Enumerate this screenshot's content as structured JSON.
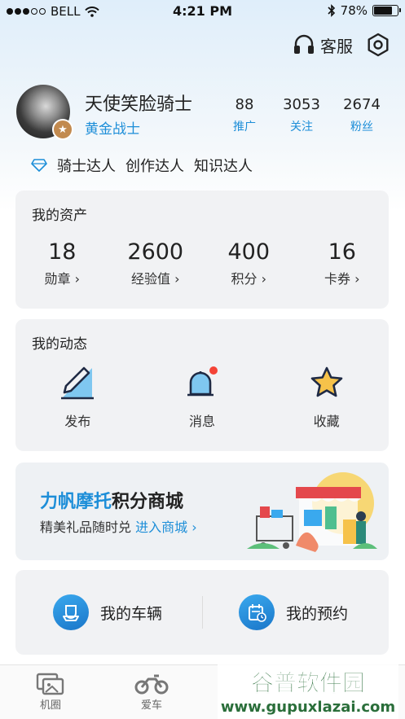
{
  "status_bar": {
    "carrier": "BELL",
    "time": "4:21 PM",
    "battery": "78%",
    "battery_level": 0.78
  },
  "header": {
    "service_label": "客服",
    "service_icon": "headset-icon",
    "settings_icon": "hex-nut-icon"
  },
  "profile": {
    "nickname": "天使笑脸骑士",
    "rank": "黄金战士",
    "stats": [
      {
        "value": "88",
        "label": "推广"
      },
      {
        "value": "3053",
        "label": "关注"
      },
      {
        "value": "2674",
        "label": "粉丝"
      }
    ],
    "tags": [
      "骑士达人",
      "创作达人",
      "知识达人"
    ]
  },
  "assets": {
    "title": "我的资产",
    "items": [
      {
        "value": "18",
        "label": "勋章 ›"
      },
      {
        "value": "2600",
        "label": "经验值 ›"
      },
      {
        "value": "400",
        "label": "积分 ›"
      },
      {
        "value": "16",
        "label": "卡券 ›"
      }
    ]
  },
  "dynamic": {
    "title": "我的动态",
    "items": [
      {
        "label": "发布",
        "icon": "pencil-icon"
      },
      {
        "label": "消息",
        "icon": "bell-icon"
      },
      {
        "label": "收藏",
        "icon": "star-icon"
      }
    ]
  },
  "mall": {
    "title_brand": "力帆摩托",
    "title_rest": "积分商城",
    "subtitle": "精美礼品随时兑",
    "link": "进入商城 ›"
  },
  "vehicles": {
    "left_label": "我的车辆",
    "right_label": "我的预约"
  },
  "tabbar": {
    "items": [
      "机圈",
      "爱车"
    ]
  },
  "watermark": {
    "line1": "谷普软件园",
    "line2": "www.gupuxlazai.com"
  },
  "colors": {
    "accent": "#1d8ed8",
    "card_bg": "#f1f2f4",
    "badge": "#c28a4f",
    "notification": "#f44336"
  }
}
